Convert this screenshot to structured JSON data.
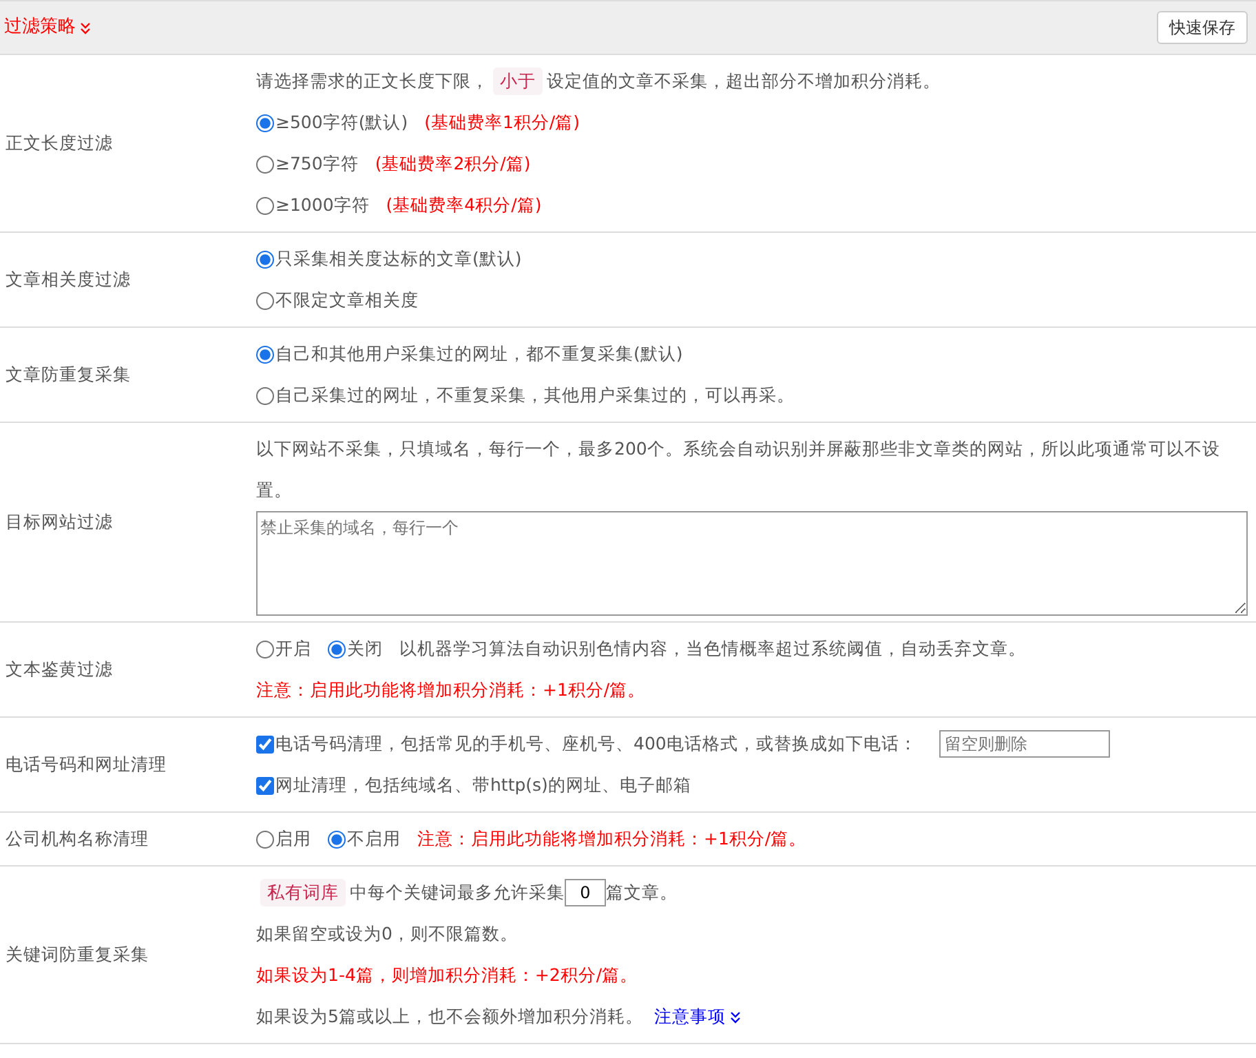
{
  "header": {
    "title": "过滤策略",
    "save_button": "快速保存"
  },
  "rows": [
    {
      "label": "正文长度过滤",
      "lines": [
        [
          {
            "kind": "text",
            "text": "请选择需求的正文长度下限，"
          },
          {
            "kind": "tag",
            "text": "小于"
          },
          {
            "kind": "text",
            "text": "设定值的文章不采集，超出部分不增加积分消耗。"
          }
        ],
        [
          {
            "kind": "radio",
            "text": "≥500字符(默认)",
            "selected": true
          },
          {
            "kind": "red",
            "text": "(基础费率1积分/篇)"
          }
        ],
        [
          {
            "kind": "radio",
            "text": "≥750字符",
            "selected": false
          },
          {
            "kind": "red",
            "text": "(基础费率2积分/篇)"
          }
        ],
        [
          {
            "kind": "radio",
            "text": "≥1000字符",
            "selected": false
          },
          {
            "kind": "red",
            "text": "(基础费率4积分/篇)"
          }
        ]
      ]
    },
    {
      "label": "文章相关度过滤",
      "lines": [
        [
          {
            "kind": "radio",
            "text": "只采集相关度达标的文章(默认)",
            "selected": true
          }
        ],
        [
          {
            "kind": "radio",
            "text": "不限定文章相关度",
            "selected": false
          }
        ]
      ]
    },
    {
      "label": "文章防重复采集",
      "lines": [
        [
          {
            "kind": "radio",
            "text": "自己和其他用户采集过的网址，都不重复采集(默认)",
            "selected": true
          }
        ],
        [
          {
            "kind": "radio",
            "text": "自己采集过的网址，不重复采集，其他用户采集过的，可以再采。",
            "selected": false
          }
        ]
      ]
    },
    {
      "label": "目标网站过滤",
      "lines": [
        [
          {
            "kind": "text",
            "text": "以下网站不采集，只填域名，每行一个，最多200个。系统会自动识别并屏蔽那些非文章类的网站，所以此项通常可以不设置。"
          }
        ],
        [
          {
            "kind": "textarea",
            "placeholder": "禁止采集的域名，每行一个"
          }
        ]
      ]
    },
    {
      "label": "文本鉴黄过滤",
      "lines": [
        [
          {
            "kind": "radio",
            "text": "开启",
            "selected": false
          },
          {
            "kind": "radio",
            "text": "关闭",
            "selected": true
          },
          {
            "kind": "text",
            "text": "以机器学习算法自动识别色情内容，当色情概率超过系统阈值，自动丢弃文章。"
          }
        ],
        [
          {
            "kind": "red",
            "text": "注意：启用此功能将增加积分消耗：+1积分/篇。"
          }
        ]
      ]
    },
    {
      "label": "电话号码和网址清理",
      "lines": [
        [
          {
            "kind": "checkbox",
            "text": "电话号码清理，包括常见的手机号、座机号、400电话格式，或替换成如下电话：",
            "checked": true
          },
          {
            "kind": "input",
            "placeholder": "留空则删除"
          }
        ],
        [
          {
            "kind": "checkbox",
            "text": "网址清理，包括纯域名、带http(s)的网址、电子邮箱",
            "checked": true
          }
        ]
      ]
    },
    {
      "label": "公司机构名称清理",
      "lines": [
        [
          {
            "kind": "radio",
            "text": "启用",
            "selected": false
          },
          {
            "kind": "radio",
            "text": "不启用",
            "selected": true
          },
          {
            "kind": "red",
            "text": "注意：启用此功能将增加积分消耗：+1积分/篇。"
          }
        ]
      ]
    },
    {
      "label": "关键词防重复采集",
      "lines": [
        [
          {
            "kind": "tag",
            "text": "私有词库"
          },
          {
            "kind": "text",
            "text": "中每个关键词最多允许采集"
          },
          {
            "kind": "number",
            "value": "0"
          },
          {
            "kind": "text",
            "text": "篇文章。"
          }
        ],
        [
          {
            "kind": "text",
            "text": "如果留空或设为0，则不限篇数。"
          }
        ],
        [
          {
            "kind": "red",
            "text": "如果设为1-4篇，则增加积分消耗：+2积分/篇。"
          }
        ],
        [
          {
            "kind": "text",
            "text": "如果设为5篇或以上，也不会额外增加积分消耗。"
          },
          {
            "kind": "link",
            "text": "注意事项"
          }
        ]
      ]
    }
  ]
}
